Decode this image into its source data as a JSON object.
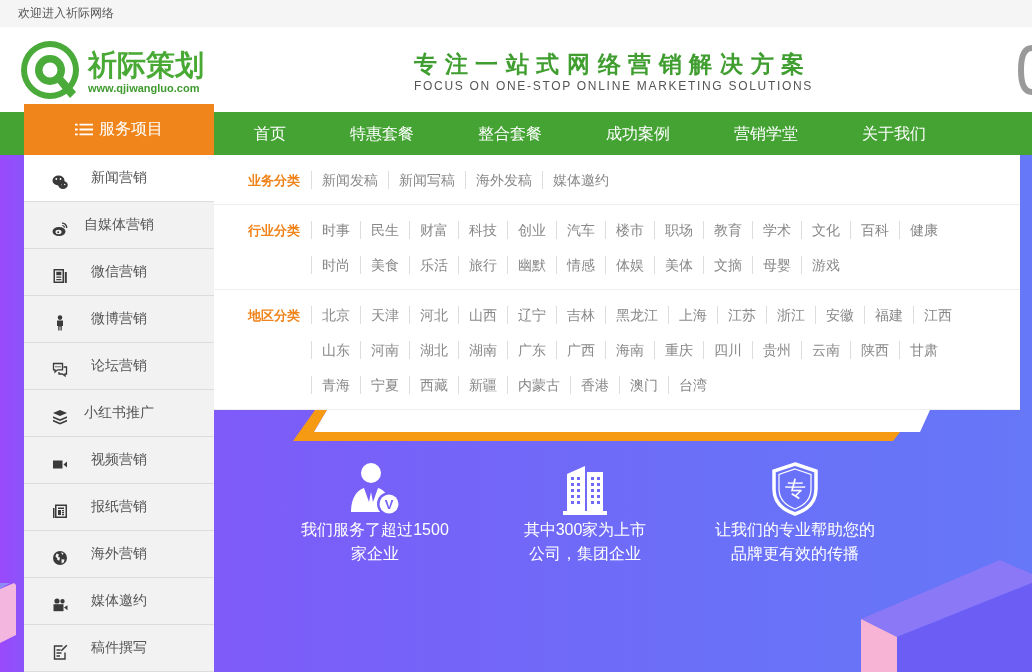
{
  "top_bar": {
    "welcome": "欢迎进入祈际网络"
  },
  "header": {
    "logo_name": "祈际策划",
    "logo_url": "www.qjiwangluo.com",
    "slogan": "专注一站式网络营销解决方案",
    "slogan_en": "FOCUS ON ONE-STOP ONLINE MARKETING SOLUTIONS"
  },
  "nav": {
    "category_button": "服务项目",
    "items": [
      "首页",
      "特惠套餐",
      "整合套餐",
      "成功案例",
      "营销学堂",
      "关于我们"
    ]
  },
  "sidebar": {
    "items": [
      {
        "label": "新闻营销",
        "selected": true
      },
      {
        "label": "自媒体营销",
        "selected": false
      },
      {
        "label": "微信营销",
        "selected": false
      },
      {
        "label": "微博营销",
        "selected": false
      },
      {
        "label": "论坛营销",
        "selected": false
      },
      {
        "label": "小红书推广",
        "selected": false
      },
      {
        "label": "视频营销",
        "selected": false
      },
      {
        "label": "报纸营销",
        "selected": false
      },
      {
        "label": "海外营销",
        "selected": false
      },
      {
        "label": "媒体邀约",
        "selected": false
      },
      {
        "label": "稿件撰写",
        "selected": false
      }
    ]
  },
  "dropdown": {
    "sections": [
      {
        "title": "业务分类",
        "links": [
          "新闻发稿",
          "新闻写稿",
          "海外发稿",
          "媒体邀约"
        ]
      },
      {
        "title": "行业分类",
        "links": [
          "时事",
          "民生",
          "财富",
          "科技",
          "创业",
          "汽车",
          "楼市",
          "职场",
          "教育",
          "学术",
          "文化",
          "百科",
          "健康",
          "时尚",
          "美食",
          "乐活",
          "旅行",
          "幽默",
          "情感",
          "体娱",
          "美体",
          "文摘",
          "母婴",
          "游戏"
        ]
      },
      {
        "title": "地区分类",
        "links": [
          "北京",
          "天津",
          "河北",
          "山西",
          "辽宁",
          "吉林",
          "黑龙江",
          "上海",
          "江苏",
          "浙江",
          "安徽",
          "福建",
          "江西",
          "山东",
          "河南",
          "湖北",
          "湖南",
          "广东",
          "广西",
          "海南",
          "重庆",
          "四川",
          "贵州",
          "云南",
          "陕西",
          "甘肃",
          "青海",
          "宁夏",
          "西藏",
          "新疆",
          "内蒙古",
          "香港",
          "澳门",
          "台湾"
        ]
      }
    ]
  },
  "banner": {
    "features": [
      {
        "badge": "V",
        "lines": [
          "我们服务了超过1500",
          "家企业"
        ]
      },
      {
        "lines": [
          "其中300家为上市",
          "公司，集团企业"
        ]
      },
      {
        "badge": "专",
        "lines": [
          "让我们的专业帮助您的",
          "品牌更有效的传播"
        ]
      }
    ]
  }
}
